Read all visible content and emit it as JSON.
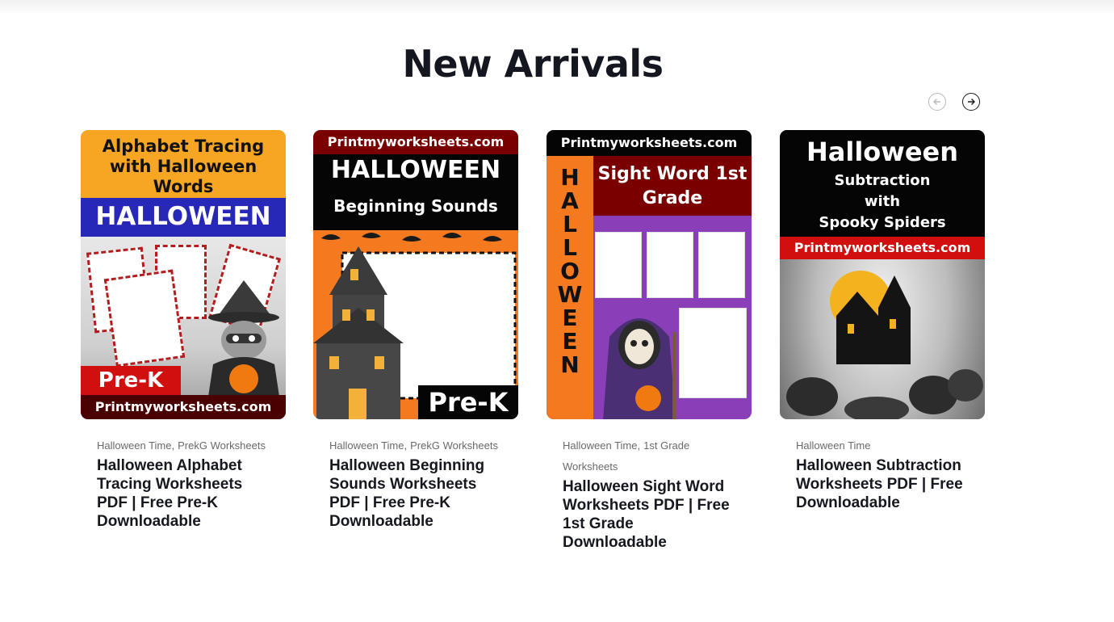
{
  "section": {
    "title": "New Arrivals"
  },
  "nav": {
    "prev_icon": "arrow-left-circle-icon",
    "next_icon": "arrow-right-circle-icon"
  },
  "products": [
    {
      "categories": [
        "Halloween Time",
        "PrekG Worksheets"
      ],
      "title": "Halloween Alphabet Tracing Worksheets PDF | Free Pre-K Downloadable",
      "cover": {
        "heading": "Alphabet Tracing with Halloween Words",
        "banner": "HALLOWEEN",
        "badge": "Pre-K",
        "site": "Printmyworksheets.com"
      }
    },
    {
      "categories": [
        "Halloween Time",
        "PrekG Worksheets"
      ],
      "title": "Halloween Beginning Sounds Worksheets PDF | Free Pre-K Downloadable",
      "cover": {
        "site": "Printmyworksheets.com",
        "heading": "HALLOWEEN",
        "subheading": "Beginning Sounds",
        "badge": "Pre-K"
      }
    },
    {
      "categories": [
        "Halloween Time",
        "1st Grade Worksheets"
      ],
      "title": "Halloween Sight Word Worksheets PDF | Free 1st Grade Downloadable",
      "cover": {
        "site": "Printmyworksheets.com",
        "vertical": "HALLOWEEN",
        "heading": "Sight Word 1st Grade"
      }
    },
    {
      "categories": [
        "Halloween Time"
      ],
      "title": "Halloween Subtraction Worksheets PDF | Free Downloadable",
      "cover": {
        "heading": "Halloween",
        "subheading": "Subtraction with Spooky Spiders",
        "site": "Printmyworksheets.com"
      }
    }
  ],
  "colors": {
    "title": "#14171f",
    "category_text": "#6a6a6a",
    "product_title": "#16181f"
  }
}
